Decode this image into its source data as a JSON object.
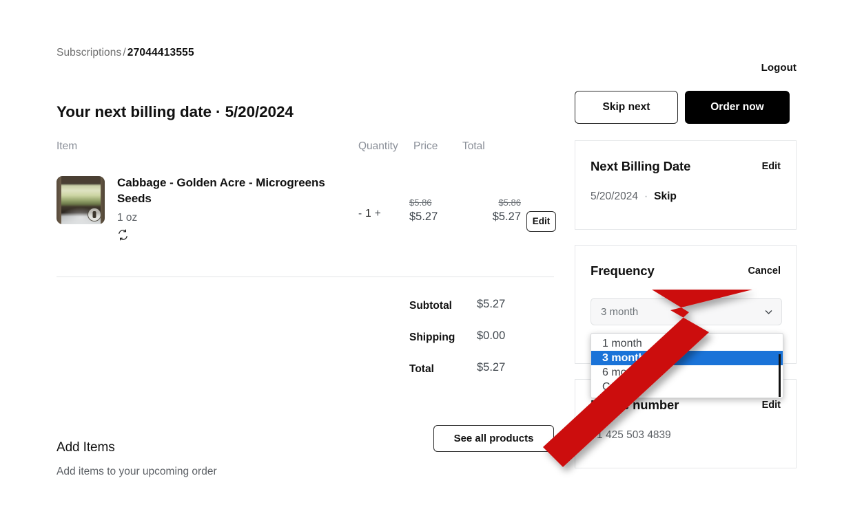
{
  "breadcrumb": {
    "parent": "Subscriptions",
    "separator": "/",
    "current": "27044413555"
  },
  "header": {
    "logout_label": "Logout"
  },
  "billing": {
    "heading": "Your next billing date · 5/20/2024"
  },
  "table": {
    "headers": {
      "item": "Item",
      "quantity": "Quantity",
      "price": "Price",
      "total": "Total"
    },
    "rows": [
      {
        "title": "Cabbage - Golden Acre - Microgreens Seeds",
        "variant": "1 oz",
        "recurring_icon": "recurring-arrows-icon",
        "quantity": "1",
        "decrement": "-",
        "increment": "+",
        "price_original": "$5.86",
        "price_current": "$5.27",
        "total_original": "$5.86",
        "total_current": "$5.27",
        "edit_label": "Edit"
      }
    ]
  },
  "totals": [
    {
      "label": "Subtotal",
      "value": "$5.27"
    },
    {
      "label": "Shipping",
      "value": "$0.00"
    },
    {
      "label": "Total",
      "value": "$5.27"
    }
  ],
  "add_items": {
    "title": "Add Items",
    "subtitle": "Add items to your upcoming order",
    "see_all_label": "See all products"
  },
  "sidebar": {
    "actions": {
      "skip_next_label": "Skip next",
      "order_now_label": "Order now"
    },
    "cards": [
      {
        "title": "Next Billing Date",
        "action": "Edit",
        "value": "5/20/2024",
        "separator": "·",
        "link": "Skip"
      },
      {
        "title": "Frequency",
        "action": "Cancel",
        "select_value": "3 month",
        "chevron_icon": "chevron-down-icon"
      },
      {
        "title": "Phone number",
        "action": "Edit",
        "value": "+1 425 503 4839"
      }
    ],
    "frequency_options": [
      {
        "label": "1 month",
        "selected": false
      },
      {
        "label": "3 month",
        "selected": true
      },
      {
        "label": "6 month",
        "selected": false
      },
      {
        "label": "Custom",
        "selected": false
      }
    ]
  },
  "annotation": {
    "pointer_icon": "red-arrow-pointer",
    "color": "#cc1111"
  },
  "colors": {
    "accent_black": "#000000",
    "select_highlight": "#1a73d8",
    "muted_text": "#5d6166",
    "header_text": "#8a8f98",
    "card_border": "#e4e6e8",
    "arrow_red": "#cc1111"
  }
}
